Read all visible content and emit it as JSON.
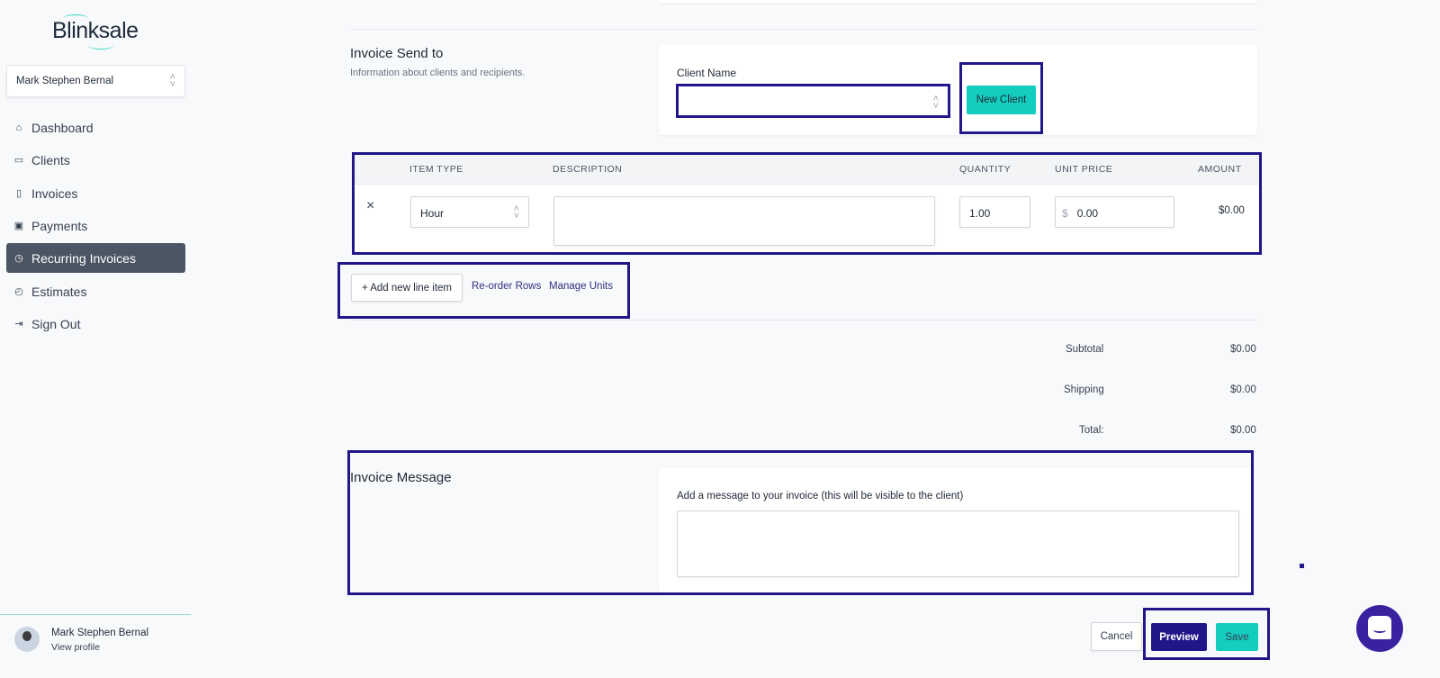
{
  "app": {
    "logo": "Blinksale",
    "account": "Mark Stephen Bernal"
  },
  "sidebar": {
    "items": [
      {
        "label": "Dashboard",
        "icon": "home-icon",
        "active": false
      },
      {
        "label": "Clients",
        "icon": "briefcase-icon",
        "active": false
      },
      {
        "label": "Invoices",
        "icon": "document-icon",
        "active": false
      },
      {
        "label": "Payments",
        "icon": "cash-icon",
        "active": false
      },
      {
        "label": "Recurring Invoices",
        "icon": "clock-icon",
        "active": true
      },
      {
        "label": "Estimates",
        "icon": "calendar-clock-icon",
        "active": false
      },
      {
        "label": "Sign Out",
        "icon": "sign-out-icon",
        "active": false
      }
    ],
    "profile": {
      "name": "Mark Stephen Bernal",
      "link": "View profile"
    }
  },
  "send_to": {
    "title": "Invoice Send to",
    "subtitle": "Information about clients and recipients.",
    "client_label": "Client Name",
    "client_value": "",
    "new_client": "New Client"
  },
  "line_items": {
    "headers": [
      "ITEM TYPE",
      "DESCRIPTION",
      "QUANTITY",
      "UNIT PRICE",
      "AMOUNT"
    ],
    "rows": [
      {
        "remove": "×",
        "item_type": "Hour",
        "description": "",
        "quantity": "1.00",
        "currency": "$",
        "unit_price": "0.00",
        "amount": "$0.00"
      }
    ],
    "add": "+ Add new line item",
    "reorder": "Re-order Rows",
    "manage_units": "Manage Units"
  },
  "totals": {
    "subtotal_label": "Subtotal",
    "subtotal": "$0.00",
    "shipping_label": "Shipping",
    "shipping": "$0.00",
    "total_label": "Total:",
    "total": "$0.00"
  },
  "message": {
    "title": "Invoice Message",
    "label": "Add a message to your invoice (this will be visible to the client)",
    "value": ""
  },
  "actions": {
    "cancel": "Cancel",
    "preview": "Preview",
    "save": "Save"
  },
  "colors": {
    "primary": "#21168a",
    "accent": "#13cdbf",
    "active_nav": "#4b5563"
  }
}
